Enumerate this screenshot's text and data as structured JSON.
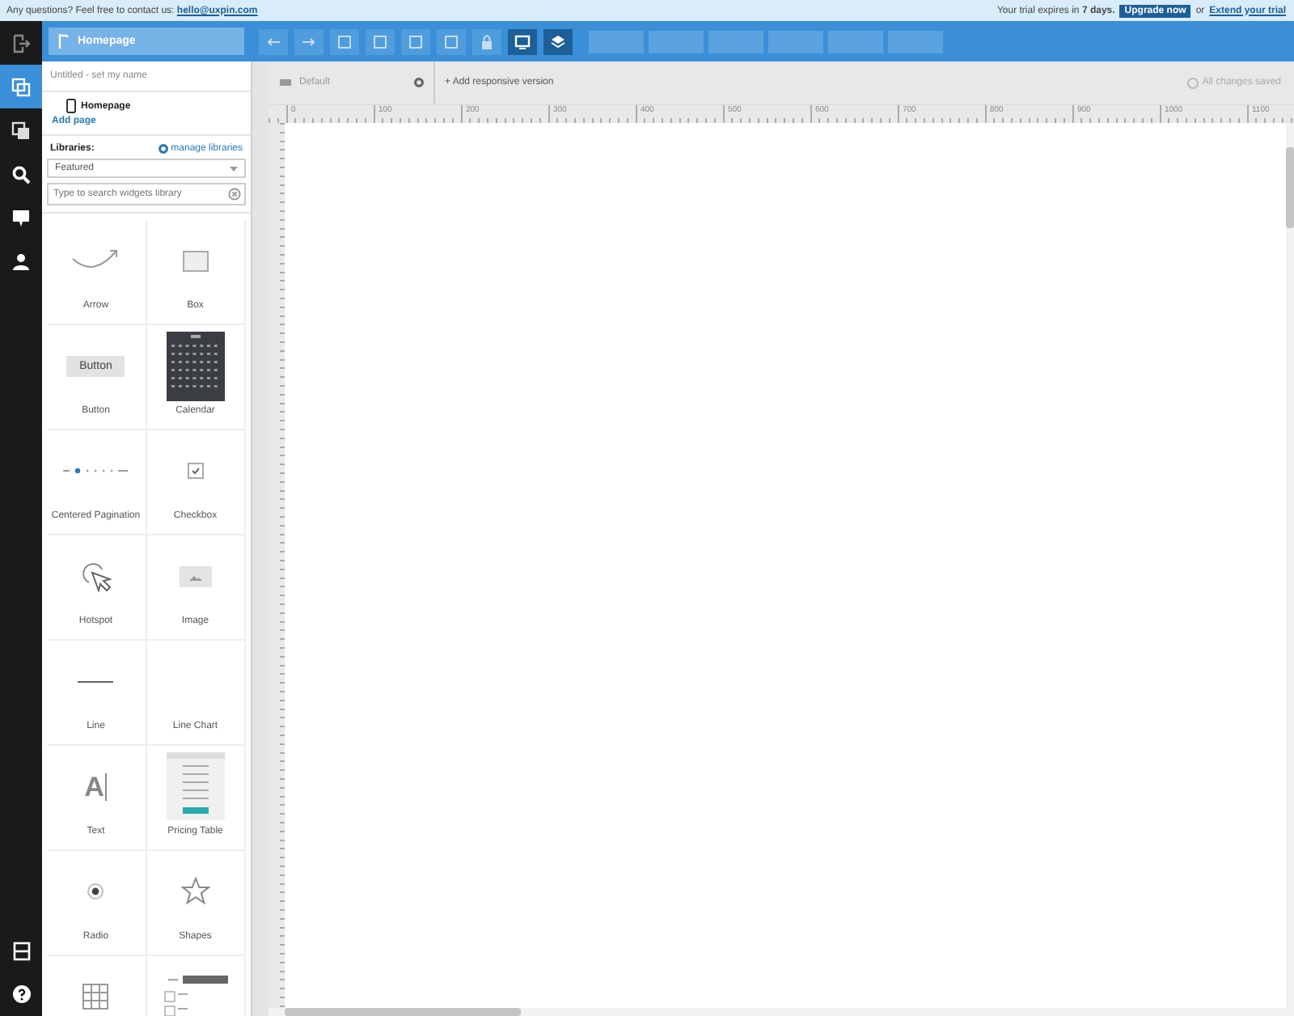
{
  "banner": {
    "question": "Any questions? Feel free to contact us:",
    "email": "hello@uxpin.com",
    "trial_prefix": "Your trial expires in",
    "trial_days": "7 days.",
    "upgrade": "Upgrade now",
    "or": "or",
    "extend": "Extend your trial"
  },
  "nav": [
    {
      "kind": "exit",
      "selected": false
    },
    {
      "kind": "pages",
      "selected": true
    },
    {
      "kind": "components",
      "selected": false
    },
    {
      "kind": "search",
      "selected": false
    },
    {
      "kind": "comment",
      "selected": false
    },
    {
      "kind": "user",
      "selected": false
    }
  ],
  "nav_bottom": [
    {
      "kind": "layout"
    },
    {
      "kind": "help"
    }
  ],
  "page_selector": "Homepage",
  "toolbar": [
    {
      "kind": "undo",
      "active": false
    },
    {
      "kind": "redo",
      "active": false
    },
    {
      "kind": "resize",
      "active": false
    },
    {
      "kind": "group",
      "active": false
    },
    {
      "kind": "align",
      "active": false
    },
    {
      "kind": "distribute",
      "active": false
    },
    {
      "kind": "lock",
      "active": false
    },
    {
      "kind": "preview",
      "active": true
    },
    {
      "kind": "layers",
      "active": true
    }
  ],
  "project_name": "Untitled - set my name",
  "pages": [
    {
      "label": "Homepage"
    }
  ],
  "add_page": "Add page",
  "libraries_label": "Libraries:",
  "manage_libraries": "manage libraries",
  "library_select": "Featured",
  "library_search": {
    "placeholder": "Type to search widgets library"
  },
  "widgets": [
    {
      "kind": "arrow",
      "label": "Arrow"
    },
    {
      "kind": "box",
      "label": "Box"
    },
    {
      "kind": "button",
      "label": "Button",
      "preview_text": "Button"
    },
    {
      "kind": "calendar",
      "label": "Calendar"
    },
    {
      "kind": "pagination",
      "label": "Centered Pagination"
    },
    {
      "kind": "checkbox",
      "label": "Checkbox"
    },
    {
      "kind": "hotspot",
      "label": "Hotspot"
    },
    {
      "kind": "image",
      "label": "Image"
    },
    {
      "kind": "line",
      "label": "Line"
    },
    {
      "kind": "linechart",
      "label": "Line Chart"
    },
    {
      "kind": "text",
      "label": "Text",
      "preview_text": "A"
    },
    {
      "kind": "pricing",
      "label": "Pricing Table"
    },
    {
      "kind": "radio",
      "label": "Radio"
    },
    {
      "kind": "shapes",
      "label": "Shapes"
    },
    {
      "kind": "table"
    },
    {
      "kind": "form"
    }
  ],
  "version_tab": "Default",
  "add_version": "+ Add responsive version",
  "save_status": "All changes saved",
  "ruler": [
    "0",
    "100",
    "200",
    "300",
    "400",
    "500",
    "600",
    "700",
    "800",
    "900",
    "1000",
    "1100"
  ]
}
